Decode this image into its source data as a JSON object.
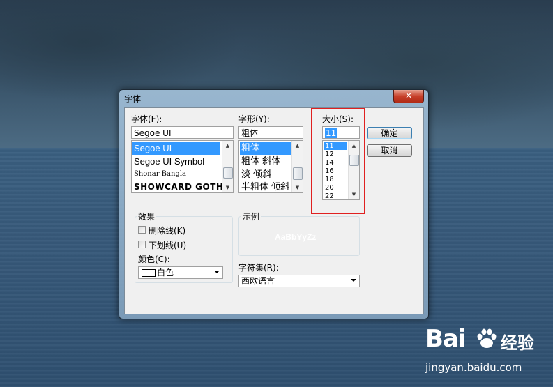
{
  "dialog": {
    "title": "字体",
    "close_symbol": "✕",
    "font": {
      "label": "字体(F):",
      "value": "Segoe UI",
      "items": [
        "Segoe UI",
        "Segoe UI Symbol",
        "Shonar Bangla",
        "SHOWCARD GOTHI"
      ],
      "selected": "Segoe UI"
    },
    "style": {
      "label": "字形(Y):",
      "value": "粗体",
      "items": [
        "粗体",
        "粗体 斜体",
        "淡 倾斜",
        "半粗体 倾斜"
      ],
      "selected": "粗体"
    },
    "size": {
      "label": "大小(S):",
      "value": "11",
      "items": [
        "11",
        "12",
        "14",
        "16",
        "18",
        "20",
        "22"
      ],
      "selected": "11"
    },
    "buttons": {
      "ok": "确定",
      "cancel": "取消"
    },
    "effects": {
      "group_label": "效果",
      "strikeout": "删除线(K)",
      "underline": "下划线(U)",
      "color_label": "颜色(C):",
      "color_value": "白色",
      "strikeout_checked": false,
      "underline_checked": false
    },
    "sample": {
      "group_label": "示例",
      "text": "AaBbYyZz"
    },
    "script": {
      "label": "字符集(R):",
      "value": "西欧语言"
    }
  },
  "watermark": {
    "brand": "Bai",
    "brand_cn": "经验",
    "url": "jingyan.baidu.com"
  },
  "colors": {
    "selection": "#3399ff",
    "highlight_box": "#e02020",
    "close_button": "#c7402a"
  }
}
